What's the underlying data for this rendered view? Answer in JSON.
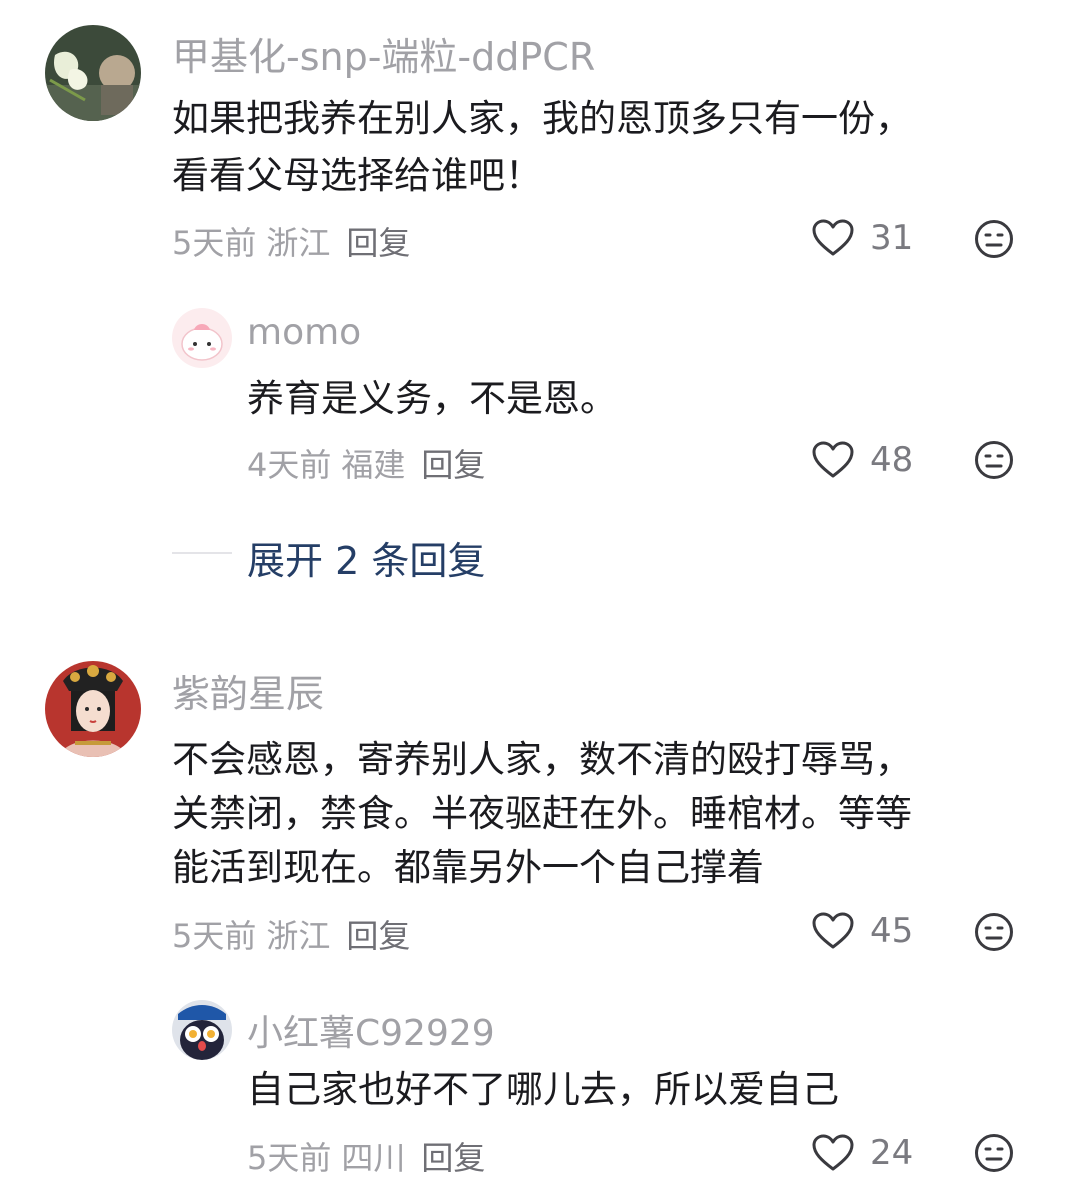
{
  "comments": [
    {
      "user": "甲基化-snp-端粒-ddPCR",
      "text_lines": [
        "如果把我养在别人家，我的恩顶多只有一份，",
        "看看父母选择给谁吧！"
      ],
      "time": "5天前",
      "location": "浙江",
      "reply_label": "回复",
      "likes": "31",
      "replies": [
        {
          "user": "momo",
          "text": "养育是义务，不是恩。",
          "time": "4天前",
          "location": "福建",
          "reply_label": "回复",
          "likes": "48"
        }
      ],
      "expand_label": "展开 2 条回复"
    },
    {
      "user": "紫韵星辰",
      "text_lines": [
        "不会感恩，寄养别人家，数不清的殴打辱骂，",
        "关禁闭，禁食。半夜驱赶在外。睡棺材。等等",
        "能活到现在。都靠另外一个自己撑着"
      ],
      "time": "5天前",
      "location": "浙江",
      "reply_label": "回复",
      "likes": "45",
      "replies": [
        {
          "user": "小红薯C92929",
          "text": "自己家也好不了哪儿去，所以爱自己",
          "time": "5天前",
          "location": "四川",
          "reply_label": "回复",
          "likes": "24"
        }
      ]
    }
  ],
  "icons": {
    "like": "heart-outline-icon",
    "dislike": "meh-face-icon"
  }
}
